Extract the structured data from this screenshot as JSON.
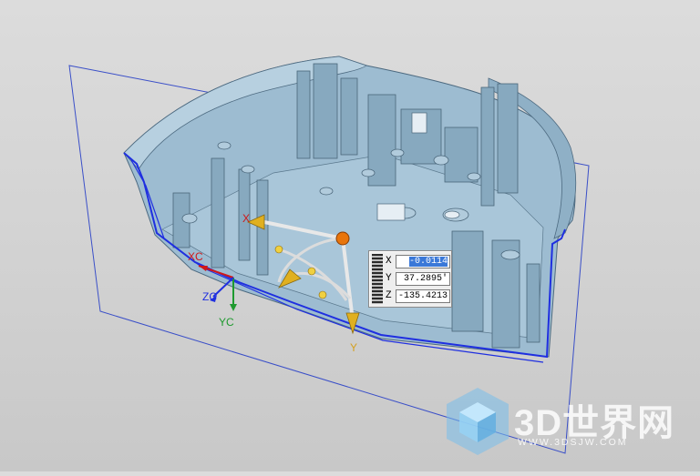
{
  "viewport": {
    "background": "#d2d2d2",
    "model_color": "#9dbcd1",
    "section_edge_color": "#1f2fe0",
    "plane_color": "#3a4fc8"
  },
  "wcs": {
    "xc_label": "XC",
    "yc_label": "YC",
    "zc_label": "ZC"
  },
  "manipulator": {
    "axis_y_label": "Y",
    "axis_x_label": "X"
  },
  "coordinate_input": {
    "x_label": "X",
    "x_value": "-0.0114",
    "y_label": "Y",
    "y_value": "37.2895'",
    "z_label": "Z",
    "z_value": "-135.4213"
  },
  "watermark": {
    "brand": "3D世界网",
    "url": "WWW.3DSJW.COM",
    "icon": "cube-logo-icon"
  }
}
